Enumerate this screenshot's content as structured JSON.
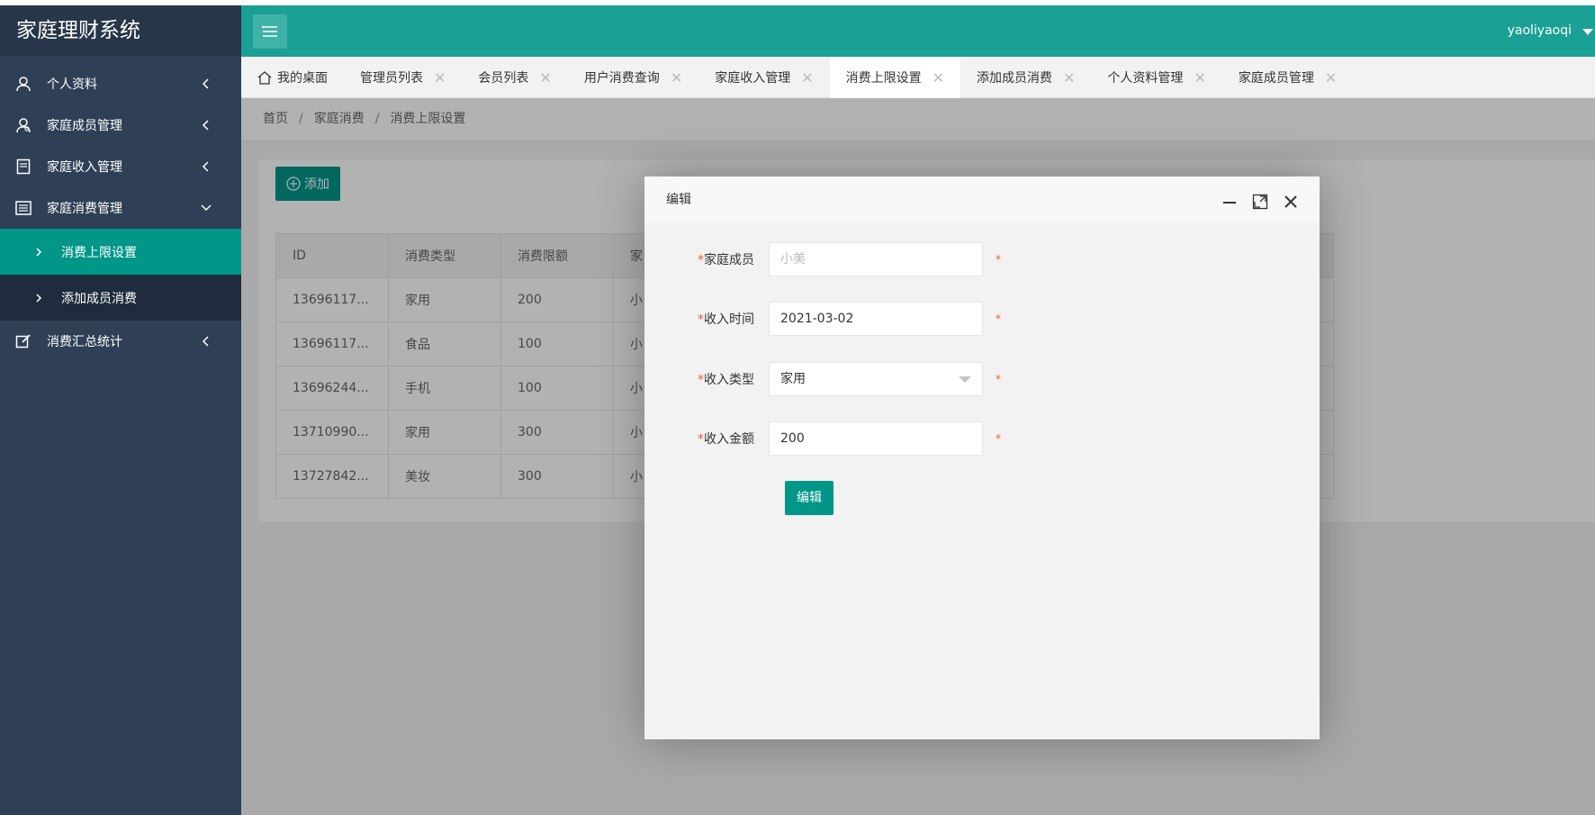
{
  "sidebar": {
    "logo": "家庭理财系统",
    "items": [
      {
        "label": "个人资料"
      },
      {
        "label": "家庭成员管理"
      },
      {
        "label": "家庭收入管理"
      },
      {
        "label": "家庭消费管理"
      },
      {
        "label": "消费汇总统计"
      }
    ],
    "sub_items": [
      {
        "label": "消费上限设置",
        "active": true
      },
      {
        "label": "添加成员消费",
        "active": false
      }
    ]
  },
  "header": {
    "user": "yaoliyaoqi"
  },
  "tabs": [
    {
      "label": "我的桌面"
    },
    {
      "label": "管理员列表"
    },
    {
      "label": "会员列表"
    },
    {
      "label": "用户消费查询"
    },
    {
      "label": "家庭收入管理"
    },
    {
      "label": "消费上限设置"
    },
    {
      "label": "添加成员消费"
    },
    {
      "label": "个人资料管理"
    },
    {
      "label": "家庭成员管理"
    }
  ],
  "breadcrumb": [
    "首页",
    "家庭消费",
    "消费上限设置"
  ],
  "add_button": "添加",
  "table": {
    "columns": [
      "ID",
      "消费类型",
      "消费限额",
      "家"
    ],
    "rows": [
      [
        "13696117...",
        "家用",
        "200",
        "小"
      ],
      [
        "13696117...",
        "食品",
        "100",
        "小"
      ],
      [
        "13696244...",
        "手机",
        "100",
        "小"
      ],
      [
        "13710990...",
        "家用",
        "300",
        "小"
      ],
      [
        "13727842...",
        "美妆",
        "300",
        "小"
      ]
    ]
  },
  "modal": {
    "title": "编辑",
    "fields": [
      {
        "label": "家庭成员",
        "value": "",
        "placeholder": "小美"
      },
      {
        "label": "收入时间",
        "value": "2021-03-02"
      },
      {
        "label": "收入类型",
        "value": "家用"
      },
      {
        "label": "收入金额",
        "value": "200"
      }
    ],
    "required_mark": "*",
    "submit": "编辑"
  },
  "colors": {
    "sidebar": "#2f4056",
    "header": "#1aa094",
    "accent": "#009688"
  }
}
